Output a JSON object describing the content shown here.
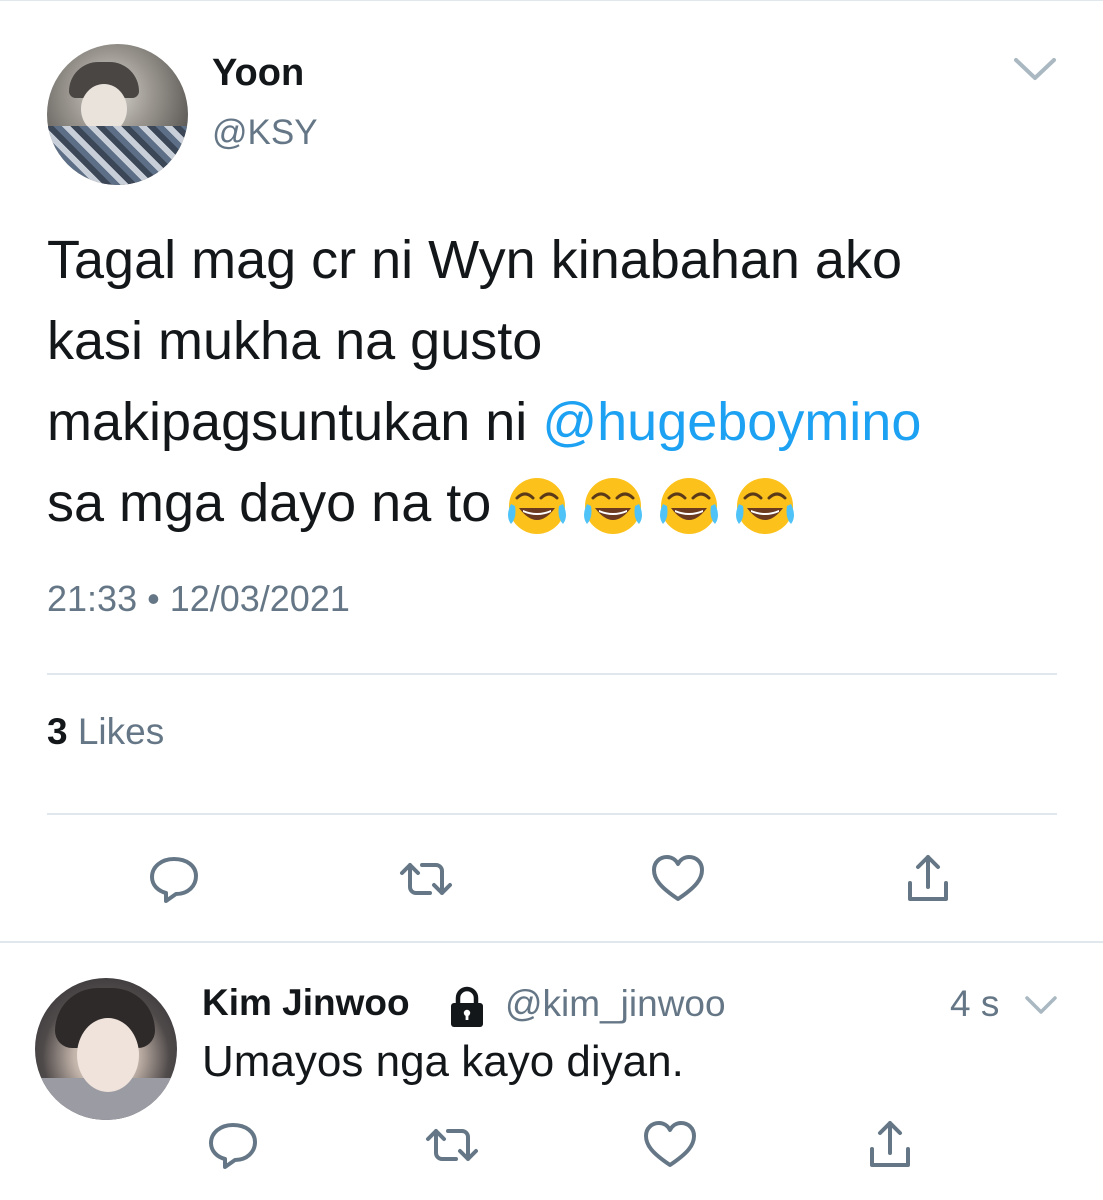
{
  "tweet": {
    "author": {
      "display_name": "Yoon",
      "handle": "@KSY"
    },
    "text_lines": {
      "line1": "Tagal mag cr ni Wyn kinabahan ako",
      "line2": "kasi mukha na gusto",
      "line3_prefix": "makipagsuntukan ni ",
      "line3_mention": "@hugeboymino",
      "line4": "sa mga dayo na to"
    },
    "emoji_icons": [
      "face-with-tears-of-joy",
      "face-with-tears-of-joy",
      "face-with-tears-of-joy",
      "face-with-tears-of-joy"
    ],
    "timestamp": "21:33 • 12/03/2021",
    "likes": {
      "count": "3",
      "label": "Likes"
    },
    "actions": [
      "reply-icon",
      "retweet-icon",
      "like-icon",
      "share-icon"
    ]
  },
  "reply": {
    "author": {
      "display_name": "Kim Jinwoo",
      "handle": "@kim_jinwoo",
      "protected_icon": "lock-icon"
    },
    "time": "4 s",
    "text": "Umayos nga kayo diyan.",
    "actions": [
      "reply-icon",
      "retweet-icon",
      "like-icon",
      "share-icon"
    ]
  },
  "colors": {
    "mention": "#1da1f2",
    "secondary_text": "#657786",
    "primary_text": "#14171a",
    "divider": "#e1e8ed"
  }
}
